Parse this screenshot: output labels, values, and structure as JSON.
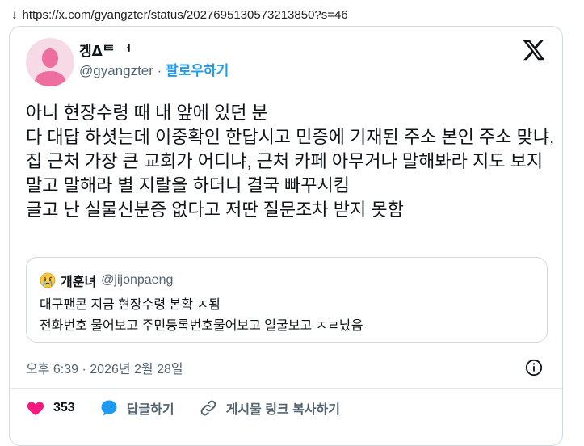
{
  "url_bar": {
    "url": "https://x.com/gyangzter/status/2027695130573213850?s=46",
    "icon": "download-arrow-icon"
  },
  "tweet": {
    "display_name": "겡ᐃᄐ ᅥ",
    "handle": "@gyangzter",
    "separator": "·",
    "follow_label": "팔로우하기",
    "text": "아니 현장수령 때 내 앞에 있던 분\n다 대답 하셧는데 이중확인 한답시고 민증에 기재된 주소 본인 주소 맞냐, 집 근처 가장 큰 교회가 어디냐, 근처 카페 아무거나 말해봐라 지도 보지말고 말해라 별 지랄을 하더니 결국 빠꾸시킴\n글고 난 실물신분증 없다고 저딴 질문조차 받지 못함",
    "timestamp": "오후 6:39 · 2026년 2월 28일"
  },
  "quote": {
    "name": "개훈녀",
    "handle": "@jijonpaeng",
    "avatar_icon": "crying-face-icon",
    "text": "대구팬콘 지금 현장수령 본확 ㅈ됨\n전화번호 물어보고 주민등록번호물어보고 얼굴보고 ㅈㄹ났음"
  },
  "actions": {
    "like_count": "353",
    "reply_label": "답글하기",
    "copy_link_label": "게시물 링크 복사하기"
  },
  "colors": {
    "accent": "#1d9bf0",
    "like": "#f91880",
    "text": "#0f1419",
    "muted": "#536471"
  }
}
